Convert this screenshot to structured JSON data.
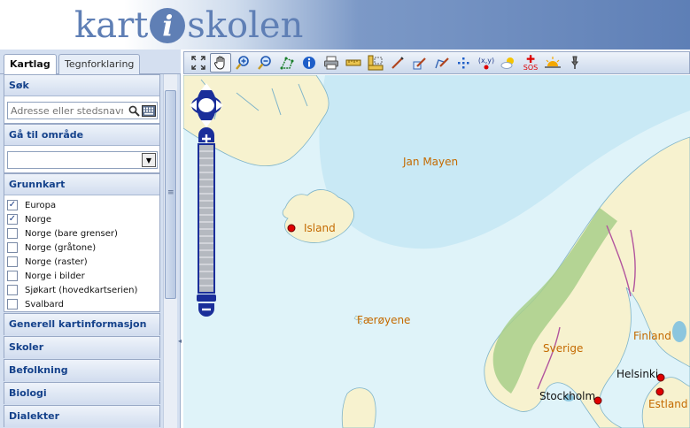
{
  "header": {
    "logo_left": "kart",
    "logo_i": "i",
    "logo_right": "skolen"
  },
  "tabs": [
    {
      "label": "Kartlag",
      "active": true
    },
    {
      "label": "Tegnforklaring",
      "active": false
    }
  ],
  "sections": {
    "search": {
      "title": "Søk",
      "placeholder": "Adresse eller stedsnavn"
    },
    "goto": {
      "title": "Gå til område",
      "selected": ""
    },
    "base": {
      "title": "Grunnkart",
      "layers": [
        {
          "label": "Europa",
          "checked": true
        },
        {
          "label": "Norge",
          "checked": true
        },
        {
          "label": "Norge (bare grenser)",
          "checked": false
        },
        {
          "label": "Norge (gråtone)",
          "checked": false
        },
        {
          "label": "Norge (raster)",
          "checked": false
        },
        {
          "label": "Norge i bilder",
          "checked": false
        },
        {
          "label": "Sjøkart (hovedkartserien)",
          "checked": false
        },
        {
          "label": "Svalbard",
          "checked": false
        }
      ]
    },
    "collapsed": [
      "Generell kartinformasjon",
      "Skoler",
      "Befolkning",
      "Biologi",
      "Dialekter"
    ]
  },
  "toolbar": {
    "icons": [
      "fullscreen-icon",
      "pan-hand-icon",
      "zoom-in-icon",
      "zoom-out-icon",
      "select-area-icon",
      "info-icon",
      "print-icon",
      "measure-length-icon",
      "measure-area-icon",
      "draw-line-icon",
      "draw-edit-icon",
      "draw-polygon-icon",
      "draw-points-icon",
      "coordinates-icon",
      "weather-icon",
      "sos-icon",
      "sunrise-icon",
      "pin-icon"
    ],
    "coord_label": "(x,y)",
    "sos_label": "SOS"
  },
  "map": {
    "labels": {
      "jan_mayen": "Jan Mayen",
      "island": "Island",
      "faeroyene": "Færøyene",
      "sverige": "Sverige",
      "finland": "Finland",
      "helsinki": "Helsinki",
      "stockholm": "Stockholm",
      "estland": "Estland"
    },
    "colors": {
      "sea": "#dff3f9",
      "land": "#f7f2cf",
      "place_label": "#c46a00",
      "border": "#b2559e",
      "city_dot": "#e00000"
    }
  }
}
